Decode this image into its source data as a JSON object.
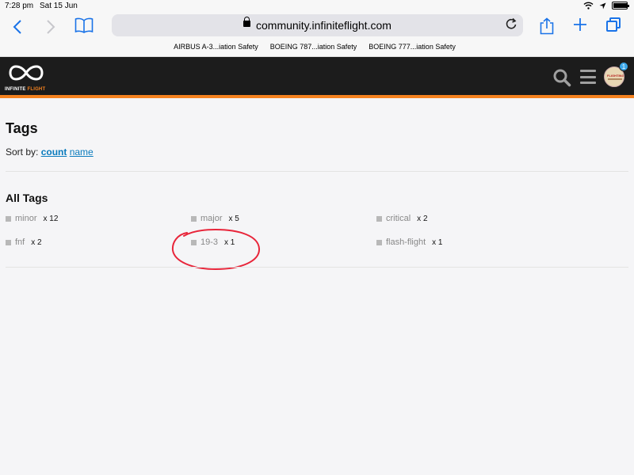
{
  "status_bar": {
    "time": "7:28 pm",
    "date": "Sat 15 Jun"
  },
  "browser": {
    "url": "community.infiniteflight.com",
    "bookmarks": [
      "AIRBUS A-3...iation Safety",
      "BOEING 787...iation Safety",
      "BOEING 777...iation Safety"
    ]
  },
  "site_header": {
    "logo_text_main": "INFINITE ",
    "logo_text_accent": "FLIGHT",
    "notification_count": "1",
    "avatar_text": "FLIGHTING"
  },
  "main": {
    "title": "Tags",
    "sort_label": "Sort by: ",
    "sort_count": "count",
    "sort_name": "name",
    "section_title": "All Tags",
    "tags": [
      {
        "name": "minor",
        "count": "x 12"
      },
      {
        "name": "major",
        "count": "x 5"
      },
      {
        "name": "critical",
        "count": "x 2"
      },
      {
        "name": "fnf",
        "count": "x 2"
      },
      {
        "name": "19-3",
        "count": "x 1"
      },
      {
        "name": "flash-flight",
        "count": "x 1"
      }
    ]
  },
  "colors": {
    "accent_orange": "#f5821f",
    "link_blue": "#0a7bbd",
    "safari_blue": "#1a73e8",
    "annotation_red": "#e8253a"
  }
}
